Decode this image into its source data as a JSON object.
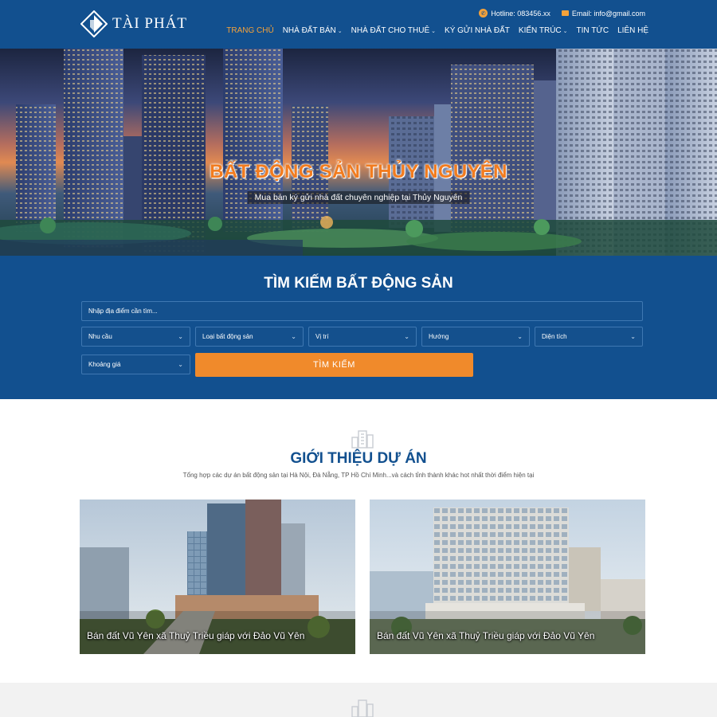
{
  "brand": {
    "name": "TÀI PHÁT"
  },
  "topbar": {
    "hotline": "Hotline: 083456.xx",
    "email": "Email: info@gmail.com"
  },
  "nav": [
    {
      "label": "TRANG CHỦ",
      "active": true,
      "dropdown": false
    },
    {
      "label": "NHÀ ĐẤT BÁN",
      "active": false,
      "dropdown": true
    },
    {
      "label": "NHÀ ĐẤT CHO THUÊ",
      "active": false,
      "dropdown": true
    },
    {
      "label": "KÝ GỬI NHÀ ĐẤT",
      "active": false,
      "dropdown": false
    },
    {
      "label": "KIẾN TRÚC",
      "active": false,
      "dropdown": true
    },
    {
      "label": "TIN TỨC",
      "active": false,
      "dropdown": false
    },
    {
      "label": "LIÊN HỆ",
      "active": false,
      "dropdown": false
    }
  ],
  "hero": {
    "title": "BẤT ĐỘNG SẢN THỦY NGUYÊN",
    "subtitle": "Mua bán ký gửi nhà đất chuyên nghiệp tại Thủy Nguyên"
  },
  "search": {
    "title": "TÌM KIẾM BẤT ĐỘNG SẢN",
    "location_placeholder": "Nhập địa điểm cần tìm...",
    "selects": {
      "need": "Nhu cầu",
      "type": "Loại bất động sản",
      "position": "Vị trí",
      "direction": "Hướng",
      "area": "Diện tích",
      "price": "Khoảng giá"
    },
    "button": "TÌM KIẾM"
  },
  "projects": {
    "title": "GIỚI THIỆU DỰ ÁN",
    "description": "Tổng hợp các dự án bất động sản tại Hà Nội, Đà Nẵng, TP Hồ Chí Minh...và cách tỉnh thành khác hot nhất thời điểm hiện tại",
    "items": [
      {
        "label": "Bán đất Vũ Yên xã Thuỷ Triều giáp với Đảo Vũ Yên"
      },
      {
        "label": "Bán đất Vũ Yên xã Thuỷ Triều giáp với Đảo Vũ Yên"
      }
    ]
  },
  "colors": {
    "primary": "#12508f",
    "accent": "#f08a2b"
  }
}
